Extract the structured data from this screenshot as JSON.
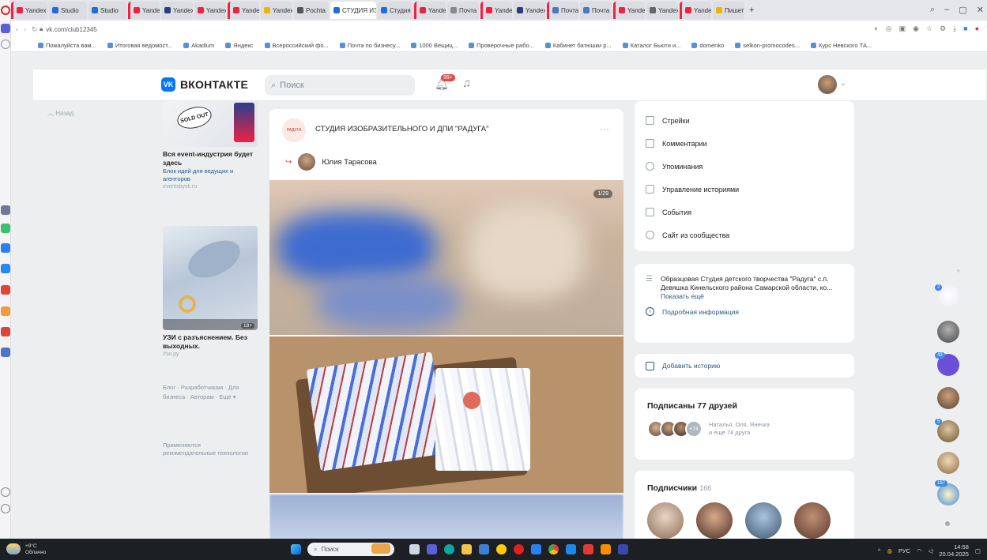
{
  "browser": {
    "tabs": [
      {
        "label": "Yandex"
      },
      {
        "label": "Studio"
      },
      {
        "label": "Studio"
      },
      {
        "label": "Yandex"
      },
      {
        "label": "Yandex"
      },
      {
        "label": "Yandex"
      },
      {
        "label": "Yandex"
      },
      {
        "label": "Yandex"
      },
      {
        "label": "Pochta"
      },
      {
        "label": "СТУДИЯ ИЗ"
      },
      {
        "label": "Студия"
      },
      {
        "label": "Yandex"
      },
      {
        "label": "Почта"
      },
      {
        "label": "Yandex"
      },
      {
        "label": "Yandex"
      },
      {
        "label": "Почта"
      },
      {
        "label": "Почта"
      },
      {
        "label": "Yandex"
      },
      {
        "label": "Yandex"
      },
      {
        "label": "Yandex"
      },
      {
        "label": "Пишет"
      }
    ],
    "window_controls": [
      "search",
      "minimize",
      "maximize",
      "close"
    ],
    "url": "vk.com/club12345",
    "bookmarks": [
      "Пожалуйста вам...",
      "Итоговая ведомост...",
      "Akadium",
      "Яндекс",
      "Всероссийский фо...",
      "Почта по бизнесу...",
      "1000 Вещиц...",
      "Проверочные рабо...",
      "Кабинет батюшки р...",
      "Каталог Бьюти и...",
      "domenko",
      "selkon-promocodes...",
      "Курс Невского ТА..."
    ]
  },
  "vk": {
    "logo_text": "ВКОНТАКТЕ",
    "search_placeholder": "Поиск",
    "notif_badge": "99+",
    "left": {
      "back_label": "Назад",
      "ad1": {
        "img_text": "SOLD OUT",
        "title": "Вся event-индустрия будет здесь",
        "desc": "Блок идей для ведущих и агенторов",
        "src": "eventsbyvk.ru"
      },
      "ad2": {
        "badge": "18+",
        "title": "УЗИ с разъяснением. Без выходных.",
        "src": "Узи.ру"
      },
      "footer_links": "Блог · Разработчикам · Для бизнеса · Авторам · Ещё ▾",
      "rec_note": "Применяются рекомендательные технологии"
    },
    "post": {
      "group_avatar_text": "РАДУГА",
      "group_name": "СТУДИЯ ИЗОБРАЗИТЕЛЬНОГО И ДПИ \"РАДУГА\"",
      "author": "Юлия Тарасова",
      "photo_count": "1/29"
    },
    "right": {
      "menu_items": [
        {
          "label": "Стрейки",
          "icon": "triangle-icon"
        },
        {
          "label": "Комментарии",
          "icon": "comment-icon"
        },
        {
          "label": "Упоминания",
          "icon": "mention-icon"
        },
        {
          "label": "Управление историями",
          "icon": "stories-icon"
        },
        {
          "label": "События",
          "icon": "calendar-icon"
        },
        {
          "label": "Сайт из сообщества",
          "icon": "globe-icon"
        }
      ],
      "about_text": "Образцовая Студия детского творчества \"Радуга\" с.п. Девяшка Кинельского района Самарской области, ко...",
      "about_more": "Показать ещё",
      "about_link": "Подробная информация",
      "add_story": "Добавить историю",
      "friends_title": "Подписаны 77 друзей",
      "friends_more_count": "+74",
      "friends_names": "Наталья, Оля, Янечка и ещё 74 друга",
      "subscribers_title": "Подписчики",
      "subscribers_count": "166"
    },
    "rail_badges": [
      "2",
      "43",
      "5",
      "197"
    ]
  },
  "taskbar": {
    "weather_temp": "+9°C",
    "weather_text": "Облачно",
    "search_label": "Поиск",
    "tray_lang": "РУС",
    "time": "14:58",
    "date": "20.04.2025"
  },
  "colors": {
    "vk_blue": "#0077ff",
    "link": "#2a5885",
    "badge_red": "#e64646",
    "taskbar": "#1c1f24"
  }
}
